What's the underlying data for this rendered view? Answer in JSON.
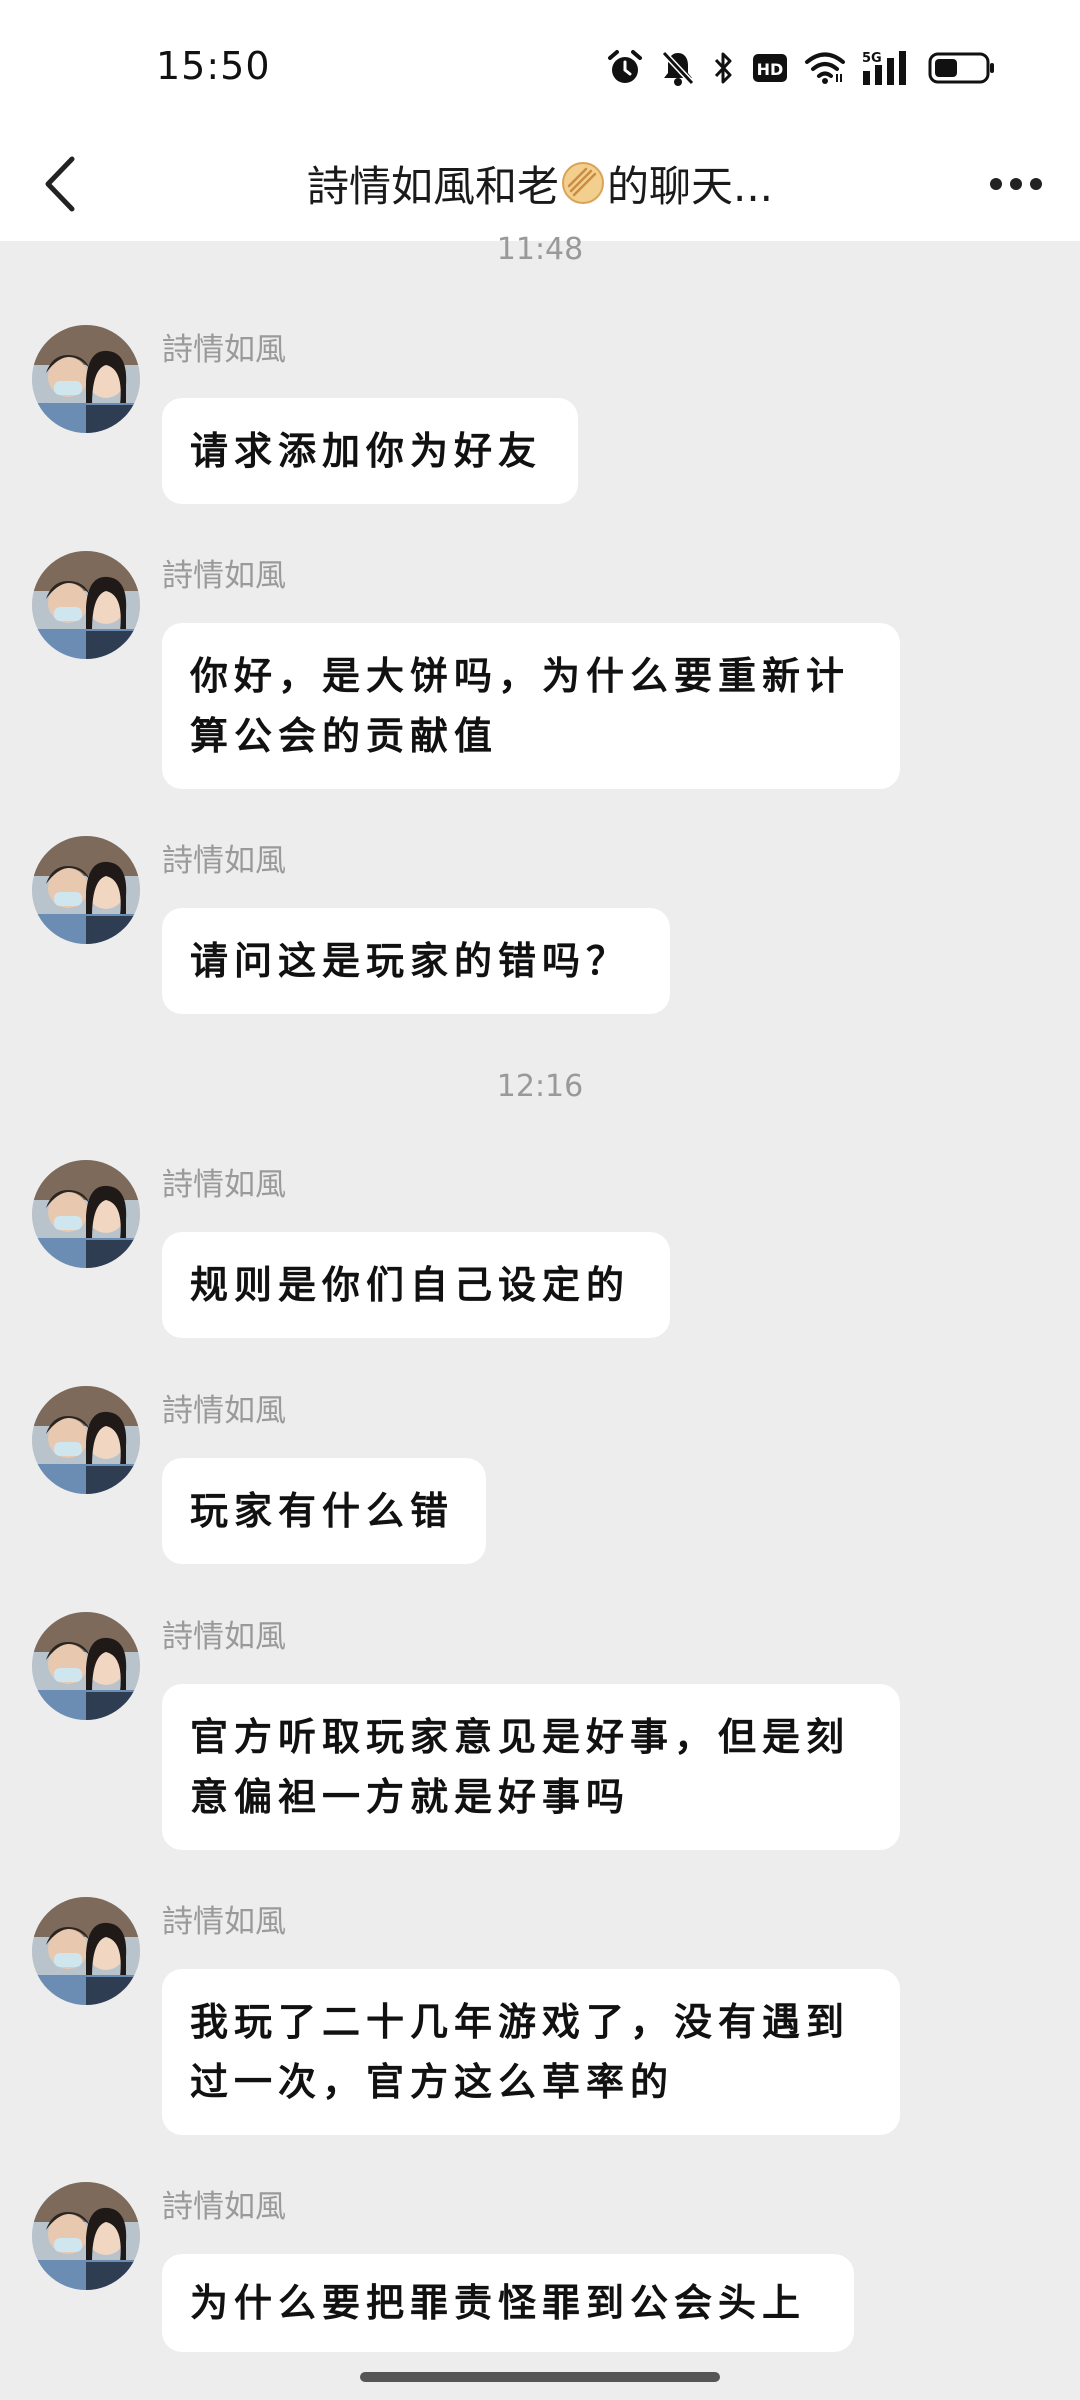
{
  "status_bar": {
    "time": "15:50",
    "icons": [
      "alarm-icon",
      "mute-icon",
      "bluetooth-icon",
      "hd-icon",
      "wifi-icon",
      "signal-5g-icon",
      "battery-icon"
    ],
    "hd_label": "HD",
    "network_label": "5G"
  },
  "header": {
    "title_before": "詩情如風和老",
    "title_emoji": "flatbread-emoji",
    "title_after": "的聊天...",
    "back_icon": "chevron-left-icon",
    "more_icon": "more-dots-icon"
  },
  "timestamps": [
    "11:48",
    "12:16"
  ],
  "messages": [
    {
      "sender": "詩情如風",
      "text": "请求添加你为好友"
    },
    {
      "sender": "詩情如風",
      "text": "你好，是大饼吗，为什么要重新计算公会的贡献值"
    },
    {
      "sender": "詩情如風",
      "text": "请问这是玩家的错吗？"
    },
    {
      "sender": "詩情如風",
      "text": "规则是你们自己设定的"
    },
    {
      "sender": "詩情如風",
      "text": "玩家有什么错"
    },
    {
      "sender": "詩情如風",
      "text": "官方听取玩家意见是好事，但是刻意偏袒一方就是好事吗"
    },
    {
      "sender": "詩情如風",
      "text": "我玩了二十几年游戏了，没有遇到过一次，官方这么草率的"
    },
    {
      "sender": "詩情如風",
      "text": "为什么要把罪责怪罪到公会头上"
    }
  ],
  "colors": {
    "background": "#ededed",
    "bubble": "#ffffff",
    "sender_text": "#9a9a9a",
    "timestamp_text": "#999999"
  }
}
